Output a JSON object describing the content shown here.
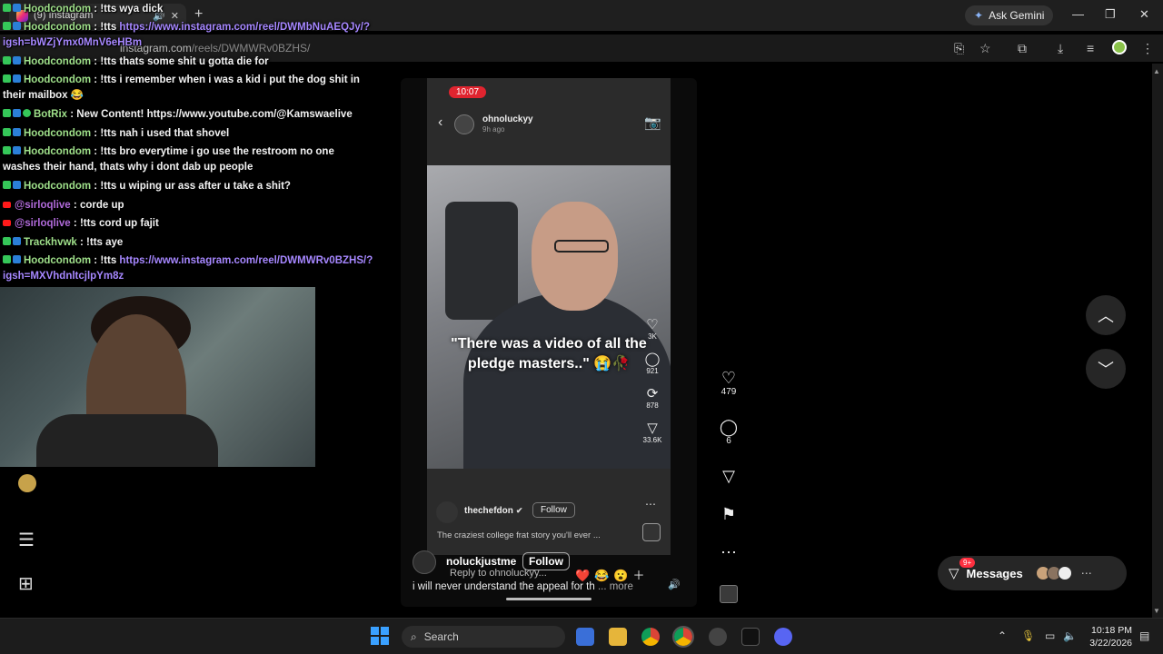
{
  "browser": {
    "tab_title": "(9) Instagram",
    "url_host": "instagram.com",
    "url_path": "/reels/DWMWRv0BZHS/",
    "ask_gemini": "Ask Gemini"
  },
  "chat": [
    {
      "user": "Hoodcondom",
      "text": " : !tts wya dick",
      "platform": "kick"
    },
    {
      "user": "Hoodcondom",
      "text": " : !tts ",
      "link": "https://www.instagram.com/reel/DWMbNuAEQJy/?igsh=bWZjYmx0MnV6eHBm",
      "platform": "kick"
    },
    {
      "user": "Hoodcondom",
      "text": " : !tts thats some shit u gotta die for",
      "platform": "kick"
    },
    {
      "user": "Hoodcondom",
      "text": " : !tts i remember when i was a kid i put the dog shit in their mailbox 😂",
      "platform": "kick"
    },
    {
      "user": "BotRix",
      "text": " : New Content! https://www.youtube.com/@Kamswaelive",
      "platform": "bot"
    },
    {
      "user": "Hoodcondom",
      "text": " : !tts nah i used that shovel",
      "platform": "kick"
    },
    {
      "user": "Hoodcondom",
      "text": " : !tts bro everytime i go use the restroom no one washes their hand, thats why i dont dab up people",
      "platform": "kick"
    },
    {
      "user": "Hoodcondom",
      "text": " : !tts u wiping ur ass after u take a shit?",
      "platform": "kick"
    },
    {
      "user": "@sirloqlive",
      "text": " : corde up",
      "platform": "youtube"
    },
    {
      "user": "@sirloqlive",
      "text": " : !tts cord up fajit",
      "platform": "youtube"
    },
    {
      "user": "Trackhvwk",
      "text": " : !tts aye",
      "platform": "kick"
    },
    {
      "user": "Hoodcondom",
      "text": " : !tts ",
      "link": "https://www.instagram.com/reel/DWMWRv0BZHS/?igsh=MXVhdnltcjlpYm8z",
      "platform": "kick"
    }
  ],
  "reel": {
    "phone_time": "10:07",
    "phone_user": "ohnoluckyy",
    "phone_ago": "9h ago",
    "caption_overlay": "\"There was a video of all the pledge masters..\" 😭🥀",
    "inner_counts": {
      "likes": "3K",
      "comments": "921",
      "reposts": "878",
      "shares": "33.6K"
    },
    "creator": "thechefdon",
    "follow_small": "Follow",
    "inner_desc": "The craziest college frat story you'll ever ...",
    "commenter": "noluckjustme",
    "follow": "Follow",
    "reply_placeholder": "Reply to ohnoluckyy...",
    "emojis": "❤️😂😮＋",
    "caption": "i will never understand the appeal for th",
    "more": "... more"
  },
  "actions": {
    "likes": "479",
    "comments": "6"
  },
  "messages": {
    "label": "Messages",
    "badge": "9+"
  },
  "taskbar": {
    "search": "Search",
    "time": "10:18 PM",
    "date": "3/22/2026"
  },
  "colors": {
    "chat_user_green": "#9fe08a",
    "chat_user_purple": "#b06ad9",
    "chat_link": "#a687ff",
    "accent_red": "#e0242f"
  }
}
